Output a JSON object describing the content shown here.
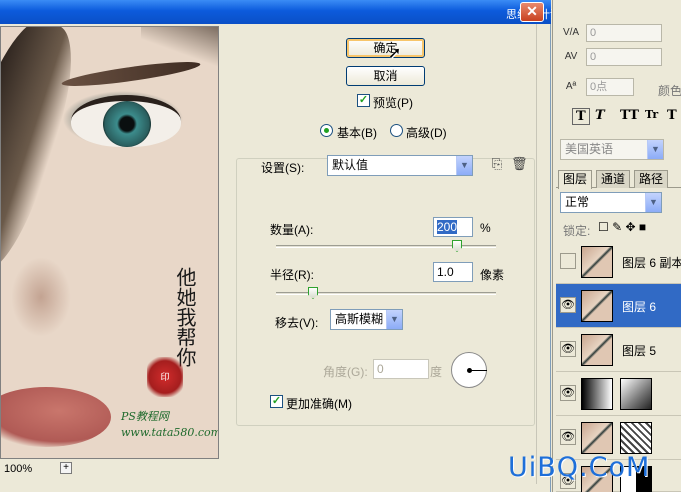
{
  "watermark_top": "思缘设计论坛",
  "dialog": {
    "ok_label": "确定",
    "cancel_label": "取消",
    "preview_label": "预览(P)",
    "basic_label": "基本(B)",
    "advanced_label": "高级(D)",
    "settings_label": "设置(S):",
    "settings_value": "默认值",
    "amount_label": "数量(A):",
    "amount_value": "200",
    "amount_unit": "%",
    "radius_label": "半径(R):",
    "radius_value": "1.0",
    "radius_unit": "像素",
    "remove_label": "移去(V):",
    "remove_value": "高斯模糊",
    "angle_label": "角度(G):",
    "angle_value": "0",
    "angle_unit": "度",
    "more_accurate_label": "更加准确(M)",
    "zoom_level": "100%",
    "zoom_plus": "+",
    "amount_slider_fraction": 0.8,
    "radius_slider_fraction": 0.1
  },
  "preview_image": {
    "calligraphy": "他她我帮你",
    "seal_text": "印",
    "site_mark": "PS教程网 www.tata580.com"
  },
  "panel": {
    "kerning_value": "0",
    "tracking_value": "0",
    "baseline_value": "0点",
    "color_label": "颜色",
    "language_value": "美国英语",
    "tabs": [
      "图层",
      "通道",
      "路径"
    ],
    "blend_mode": "正常",
    "lock_label": "锁定:",
    "layers": [
      {
        "name": "图层 6 副本",
        "visible": false
      },
      {
        "name": "图层 6",
        "visible": true,
        "active": true
      },
      {
        "name": "图层 5",
        "visible": true
      },
      {
        "name": "",
        "visible": true
      },
      {
        "name": "",
        "visible": true
      },
      {
        "name": "",
        "visible": true
      }
    ]
  },
  "site_watermark": "UiBQ.CoM"
}
